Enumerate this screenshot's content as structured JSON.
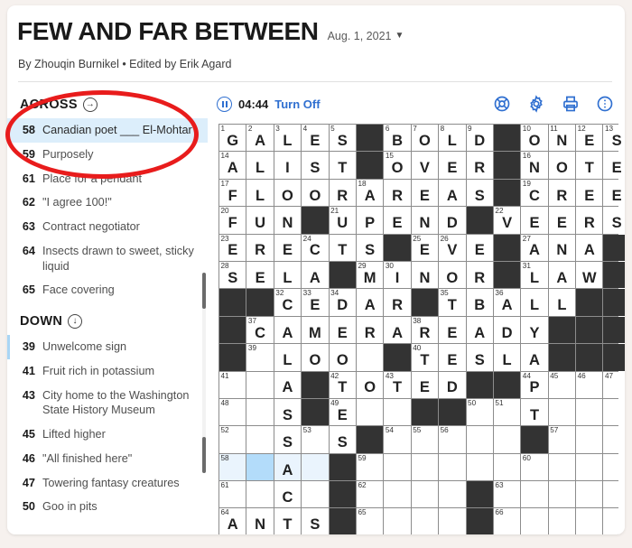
{
  "header": {
    "title": "FEW AND FAR BETWEEN",
    "date": "Aug. 1, 2021",
    "date_chevron": "chevron-down-icon",
    "byline": "By Zhouqin Burnikel • Edited by Erik Agard"
  },
  "toolbar": {
    "pause_icon": "pause-icon",
    "timer": "04:44",
    "turn_off": "Turn Off",
    "icons": [
      {
        "name": "help-lifebuoy-icon"
      },
      {
        "name": "gear-icon"
      },
      {
        "name": "print-icon"
      },
      {
        "name": "more-options-icon"
      }
    ],
    "accent_color": "#2f6fd0"
  },
  "clues": {
    "across": {
      "heading": "ACROSS",
      "arrow_icon": "arrow-right-circle-icon",
      "items": [
        {
          "num": "58",
          "text": "Canadian poet ___ El-Mohtar",
          "active": true
        },
        {
          "num": "59",
          "text": "Purposely",
          "active": false
        },
        {
          "num": "61",
          "text": "Place for a pendant",
          "active": false
        },
        {
          "num": "62",
          "text": "\"I agree 100!\"",
          "active": false
        },
        {
          "num": "63",
          "text": "Contract negotiator",
          "active": false
        },
        {
          "num": "64",
          "text": "Insects drawn to sweet, sticky liquid",
          "active": false
        },
        {
          "num": "65",
          "text": "Face covering",
          "active": false
        }
      ]
    },
    "down": {
      "heading": "DOWN",
      "arrow_icon": "arrow-down-circle-icon",
      "items": [
        {
          "num": "39",
          "text": "Unwelcome sign",
          "active": false
        },
        {
          "num": "41",
          "text": "Fruit rich in potassium",
          "active": false
        },
        {
          "num": "43",
          "text": "City home to the Washington State History Museum",
          "active": false
        },
        {
          "num": "45",
          "text": "Lifted higher",
          "active": false
        },
        {
          "num": "46",
          "text": "\"All finished here\"",
          "active": false
        },
        {
          "num": "47",
          "text": "Towering fantasy creatures",
          "active": false
        },
        {
          "num": "50",
          "text": "Goo in pits",
          "active": false
        }
      ]
    }
  },
  "annotation": {
    "shape": "ellipse",
    "color": "#e81c1c",
    "target": "clue-58-across"
  },
  "grid": {
    "size": 15,
    "highlight_color": "#eaf4fd",
    "cursor_color": "#b3dcfa",
    "block_color": "#333333",
    "rows": [
      [
        {
          "n": "1",
          "l": "G"
        },
        {
          "n": "2",
          "l": "A"
        },
        {
          "n": "3",
          "l": "L"
        },
        {
          "n": "4",
          "l": "E"
        },
        {
          "n": "5",
          "l": "S"
        },
        {
          "b": true
        },
        {
          "n": "6",
          "l": "B"
        },
        {
          "n": "7",
          "l": "O"
        },
        {
          "n": "8",
          "l": "L"
        },
        {
          "n": "9",
          "l": "D"
        },
        {
          "b": true
        },
        {
          "n": "10",
          "l": "O"
        },
        {
          "n": "11",
          "l": "N"
        },
        {
          "n": "12",
          "l": "E"
        },
        {
          "n": "13",
          "l": "S"
        }
      ],
      [
        {
          "n": "14",
          "l": "A"
        },
        {
          "l": "L"
        },
        {
          "l": "I"
        },
        {
          "l": "S"
        },
        {
          "l": "T"
        },
        {
          "b": true
        },
        {
          "n": "15",
          "l": "O"
        },
        {
          "l": "V"
        },
        {
          "l": "E"
        },
        {
          "l": "R"
        },
        {
          "b": true
        },
        {
          "n": "16",
          "l": "N"
        },
        {
          "l": "O"
        },
        {
          "l": "T"
        },
        {
          "l": "E"
        }
      ],
      [
        {
          "n": "17",
          "l": "F"
        },
        {
          "l": "L"
        },
        {
          "l": "O"
        },
        {
          "l": "O"
        },
        {
          "l": "R"
        },
        {
          "n": "18",
          "l": "A"
        },
        {
          "l": "R"
        },
        {
          "l": "E"
        },
        {
          "l": "A"
        },
        {
          "l": "S"
        },
        {
          "b": true
        },
        {
          "n": "19",
          "l": "C"
        },
        {
          "l": "R"
        },
        {
          "l": "E"
        },
        {
          "l": "E"
        }
      ],
      [
        {
          "n": "20",
          "l": "F"
        },
        {
          "l": "U"
        },
        {
          "l": "N"
        },
        {
          "b": true
        },
        {
          "n": "21",
          "l": "U"
        },
        {
          "l": "P"
        },
        {
          "l": "E"
        },
        {
          "l": "N"
        },
        {
          "l": "D"
        },
        {
          "b": true
        },
        {
          "n": "22",
          "l": "V"
        },
        {
          "l": "E"
        },
        {
          "l": "E"
        },
        {
          "l": "R"
        },
        {
          "l": "S"
        }
      ],
      [
        {
          "n": "23",
          "l": "E"
        },
        {
          "l": "R"
        },
        {
          "l": "E"
        },
        {
          "n": "24",
          "l": "C"
        },
        {
          "l": "T"
        },
        {
          "l": "S"
        },
        {
          "b": true
        },
        {
          "n": "25",
          "l": "E"
        },
        {
          "n": "26",
          "l": "V"
        },
        {
          "l": "E"
        },
        {
          "b": true
        },
        {
          "n": "27",
          "l": "A"
        },
        {
          "l": "N"
        },
        {
          "l": "A"
        },
        {
          "b": true
        }
      ],
      [
        {
          "n": "28",
          "l": "S"
        },
        {
          "l": "E"
        },
        {
          "l": "L"
        },
        {
          "l": "A"
        },
        {
          "b": true
        },
        {
          "n": "29",
          "l": "M"
        },
        {
          "n": "30",
          "l": "I"
        },
        {
          "l": "N"
        },
        {
          "l": "O"
        },
        {
          "l": "R"
        },
        {
          "b": true
        },
        {
          "n": "31",
          "l": "L"
        },
        {
          "l": "A"
        },
        {
          "l": "W"
        },
        {
          "b": true
        }
      ],
      [
        {
          "b": true
        },
        {
          "b": true
        },
        {
          "n": "32",
          "l": "C"
        },
        {
          "n": "33",
          "l": "E"
        },
        {
          "n": "34",
          "l": "D"
        },
        {
          "l": "A"
        },
        {
          "l": "R"
        },
        {
          "b": true
        },
        {
          "n": "35",
          "l": "T"
        },
        {
          "l": "B"
        },
        {
          "n": "36",
          "l": "A"
        },
        {
          "l": "L"
        },
        {
          "l": "L"
        },
        {
          "b": true
        },
        {
          "b": true
        }
      ],
      [
        {
          "b": true
        },
        {
          "n": "37",
          "l": "C"
        },
        {
          "l": "A"
        },
        {
          "l": "M"
        },
        {
          "l": "E"
        },
        {
          "l": "R"
        },
        {
          "l": "A"
        },
        {
          "n": "38",
          "l": "R"
        },
        {
          "l": "E"
        },
        {
          "l": "A"
        },
        {
          "l": "D"
        },
        {
          "l": "Y"
        },
        {
          "b": true
        },
        {
          "b": true
        },
        {
          "b": true
        }
      ],
      [
        {
          "b": true
        },
        {
          "n": "39",
          "l": ""
        },
        {
          "l": "L"
        },
        {
          "l": "O"
        },
        {
          "l": "O"
        },
        {
          "l": ""
        },
        {
          "b": true
        },
        {
          "n": "40",
          "l": "T"
        },
        {
          "l": "E"
        },
        {
          "l": "S"
        },
        {
          "l": "L"
        },
        {
          "l": "A"
        },
        {
          "b": true
        },
        {
          "b": true
        },
        {
          "b": true
        }
      ],
      [
        {
          "n": "41",
          "l": ""
        },
        {
          "l": ""
        },
        {
          "l": "A"
        },
        {
          "b": true
        },
        {
          "n": "42",
          "l": "T"
        },
        {
          "l": "O"
        },
        {
          "n": "43",
          "l": "T"
        },
        {
          "l": "E"
        },
        {
          "l": "D"
        },
        {
          "b": true
        },
        {
          "b": true
        },
        {
          "n": "44",
          "l": "P"
        },
        {
          "n": "45",
          "l": ""
        },
        {
          "n": "46",
          "l": ""
        },
        {
          "n": "47",
          "l": ""
        }
      ],
      [
        {
          "n": "48",
          "l": ""
        },
        {
          "l": ""
        },
        {
          "l": "S"
        },
        {
          "b": true
        },
        {
          "n": "49",
          "l": "E"
        },
        {
          "l": ""
        },
        {
          "l": ""
        },
        {
          "b": true
        },
        {
          "b": true
        },
        {
          "n": "50",
          "l": ""
        },
        {
          "n": "51",
          "l": ""
        },
        {
          "l": "T"
        },
        {
          "l": ""
        },
        {
          "l": ""
        },
        {
          "l": ""
        }
      ],
      [
        {
          "n": "52",
          "l": ""
        },
        {
          "l": ""
        },
        {
          "l": "S"
        },
        {
          "n": "53",
          "l": ""
        },
        {
          "l": "S"
        },
        {
          "b": true
        },
        {
          "n": "54",
          "l": ""
        },
        {
          "n": "55",
          "l": ""
        },
        {
          "n": "56",
          "l": ""
        },
        {
          "l": ""
        },
        {
          "l": ""
        },
        {
          "b": true
        },
        {
          "n": "57",
          "l": ""
        },
        {
          "l": ""
        },
        {
          "l": ""
        }
      ],
      [
        {
          "n": "58",
          "l": "",
          "hl": true
        },
        {
          "l": "",
          "cur": true
        },
        {
          "l": "A",
          "hl": true
        },
        {
          "l": "",
          "hl": true
        },
        {
          "b": true
        },
        {
          "n": "59",
          "l": ""
        },
        {
          "l": ""
        },
        {
          "l": ""
        },
        {
          "l": ""
        },
        {
          "l": ""
        },
        {
          "l": ""
        },
        {
          "n": "60",
          "l": ""
        },
        {
          "l": ""
        },
        {
          "l": ""
        },
        {
          "l": ""
        }
      ],
      [
        {
          "n": "61",
          "l": ""
        },
        {
          "l": ""
        },
        {
          "l": "C"
        },
        {
          "l": ""
        },
        {
          "b": true
        },
        {
          "n": "62",
          "l": ""
        },
        {
          "l": ""
        },
        {
          "l": ""
        },
        {
          "l": ""
        },
        {
          "b": true
        },
        {
          "n": "63",
          "l": ""
        },
        {
          "l": ""
        },
        {
          "l": ""
        },
        {
          "l": ""
        },
        {
          "l": ""
        }
      ],
      [
        {
          "n": "64",
          "l": "A"
        },
        {
          "l": "N"
        },
        {
          "l": "T"
        },
        {
          "l": "S"
        },
        {
          "b": true
        },
        {
          "n": "65",
          "l": ""
        },
        {
          "l": ""
        },
        {
          "l": ""
        },
        {
          "l": ""
        },
        {
          "b": true
        },
        {
          "n": "66",
          "l": ""
        },
        {
          "l": ""
        },
        {
          "l": ""
        },
        {
          "l": ""
        },
        {
          "l": ""
        }
      ]
    ]
  }
}
